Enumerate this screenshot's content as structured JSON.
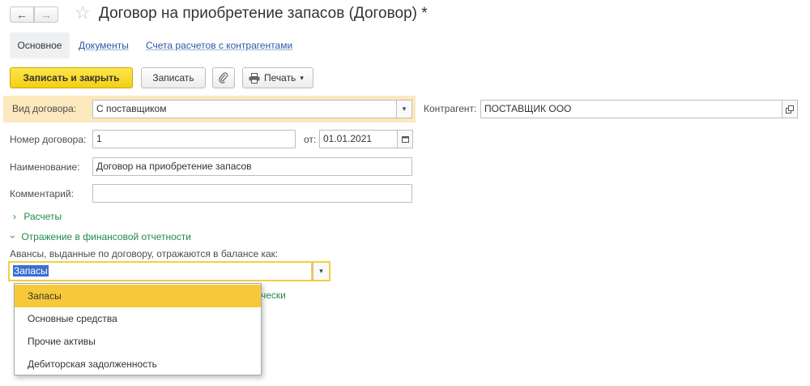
{
  "header": {
    "back_icon": "arrow-left-icon",
    "forward_icon": "arrow-right-icon",
    "favorite_icon": "star-icon",
    "title": "Договор на приобретение запасов (Договор) *"
  },
  "tabs": [
    {
      "label": "Основное",
      "active": true
    },
    {
      "label": "Документы",
      "active": false
    },
    {
      "label": "Счета расчетов с контрагентами",
      "active": false
    }
  ],
  "toolbar": {
    "save_close": "Записать и закрыть",
    "save": "Записать",
    "attach_icon": "paperclip-icon",
    "print_icon": "printer-icon",
    "print": "Печать",
    "print_arrow": "▾"
  },
  "form": {
    "contract_type": {
      "label": "Вид договора:",
      "value": "С поставщиком"
    },
    "counterparty": {
      "label": "Контрагент:",
      "value": "ПОСТАВЩИК ООО"
    },
    "number": {
      "label": "Номер договора:",
      "value": "1"
    },
    "date": {
      "label": "от:",
      "value": "01.01.2021"
    },
    "name": {
      "label": "Наименование:",
      "value": "Договор на приобретение запасов"
    },
    "comment": {
      "label": "Комментарий:",
      "value": ""
    }
  },
  "sections": {
    "settlements": "Расчеты",
    "financial": "Отражение в финансовой отчетности"
  },
  "advances": {
    "label": "Авансы, выданные по договору, отражаются в балансе как:",
    "value": "Запасы",
    "behind_text": "чески"
  },
  "dropdown": {
    "items": [
      "Запасы",
      "Основные средства",
      "Прочие активы",
      "Дебиторская задолженность"
    ],
    "selected_index": 0
  },
  "colors": {
    "accent_yellow": "#f4cf14",
    "highlight": "#fbe8bd",
    "link_blue": "#2d56a8",
    "link_green": "#1f8a4a",
    "selection_blue": "#3c6fd1"
  }
}
